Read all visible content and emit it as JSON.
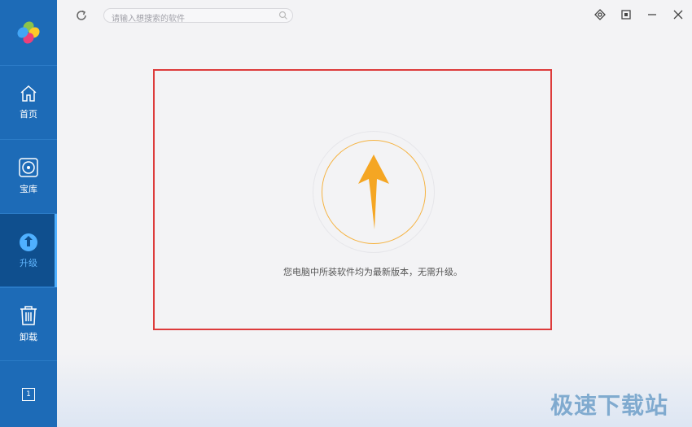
{
  "sidebar": {
    "logo_name": "app-logo",
    "items": [
      {
        "label": "首页",
        "icon": "home-icon"
      },
      {
        "label": "宝库",
        "icon": "disc-icon"
      },
      {
        "label": "升级",
        "icon": "upgrade-icon",
        "active": true
      },
      {
        "label": "卸载",
        "icon": "trash-icon"
      }
    ],
    "counter": "1"
  },
  "topbar": {
    "search_placeholder": "请输入想搜索的软件",
    "buttons": [
      "refresh-icon",
      "skin-icon",
      "settings-icon",
      "minimize-icon",
      "close-icon"
    ]
  },
  "main": {
    "message": "您电脑中所装软件均为最新版本，无需升级。"
  },
  "watermark": "极速下载站",
  "colors": {
    "sidebar": "#1d6bb7",
    "active_nav": "#0f4f8e",
    "highlight_border": "#dd3b3b",
    "arrow": "#f5a623",
    "ring": "#f5b342"
  }
}
